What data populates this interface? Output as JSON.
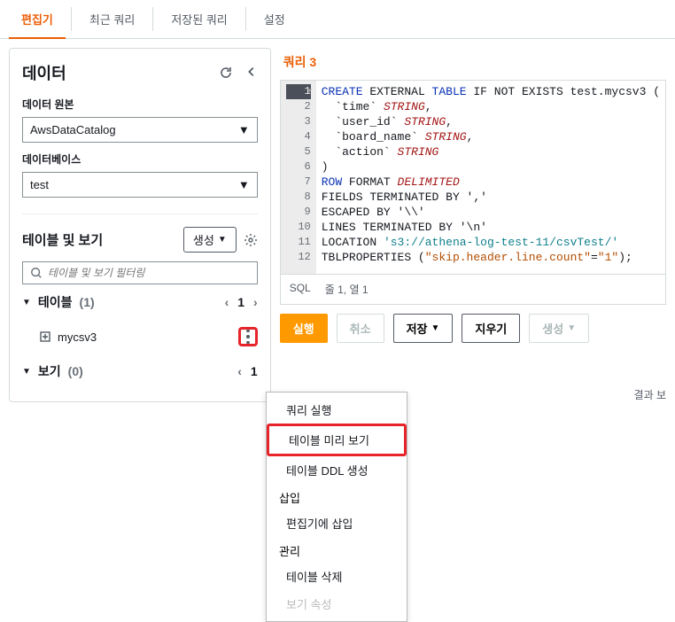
{
  "topTabs": [
    "편집기",
    "최근 쿼리",
    "저장된 쿼리",
    "설정"
  ],
  "sidebar": {
    "title": "데이터",
    "labels": {
      "source": "데이터 원본",
      "database": "데이터베이스",
      "section": "테이블 및 보기",
      "createBtn": "생성",
      "filterPlaceholder": "테이블 및 보기 필터링"
    },
    "sourceValue": "AwsDataCatalog",
    "databaseValue": "test",
    "tablesHeader": "테이블",
    "tablesCount": "(1)",
    "viewsHeader": "보기",
    "viewsCount": "(0)",
    "tableItem": "mycsv3",
    "pageNum": "1"
  },
  "query": {
    "tab": "쿼리 3",
    "lines": [
      "1",
      "2",
      "3",
      "4",
      "5",
      "6",
      "7",
      "8",
      "9",
      "10",
      "11",
      "12"
    ],
    "code": {
      "l1a": "CREATE",
      "l1b": " EXTERNAL ",
      "l1c": "TABLE",
      "l1d": " IF NOT EXISTS test.mycsv3 (",
      "l2a": "  `time` ",
      "l2b": "STRING",
      "l2c": ",",
      "l3a": "  `user_id` ",
      "l3b": "STRING",
      "l3c": ",",
      "l4a": "  `board_name` ",
      "l4b": "STRING",
      "l4c": ",",
      "l5a": "  `action` ",
      "l5b": "STRING",
      "l6": ")",
      "l7a": "ROW",
      "l7b": " FORMAT ",
      "l7c": "DELIMITED",
      "l8": "FIELDS TERMINATED BY ','",
      "l9": "ESCAPED BY '\\\\'",
      "l10": "LINES TERMINATED BY '\\n'",
      "l11a": "LOCATION ",
      "l11b": "'s3://athena-log-test-11/csvTest/'",
      "l12a": "TBLPROPERTIES (",
      "l12b": "\"skip.header.line.count\"",
      "l12c": "=",
      "l12d": "\"1\"",
      "l12e": ");"
    },
    "status": {
      "lang": "SQL",
      "pos": "줄 1, 열 1"
    },
    "buttons": {
      "run": "실행",
      "cancel": "취소",
      "save": "저장",
      "clear": "지우기",
      "create": "생성"
    },
    "resultHint": "결과 보"
  },
  "contextMenu": {
    "runQuery": "쿼리 실행",
    "preview": "테이블 미리 보기",
    "genDDL": "테이블 DDL 생성",
    "insertHdr": "삽입",
    "insertEditor": "편집기에 삽입",
    "manageHdr": "관리",
    "deleteTable": "테이블 삭제",
    "partial": "보기 속성"
  }
}
